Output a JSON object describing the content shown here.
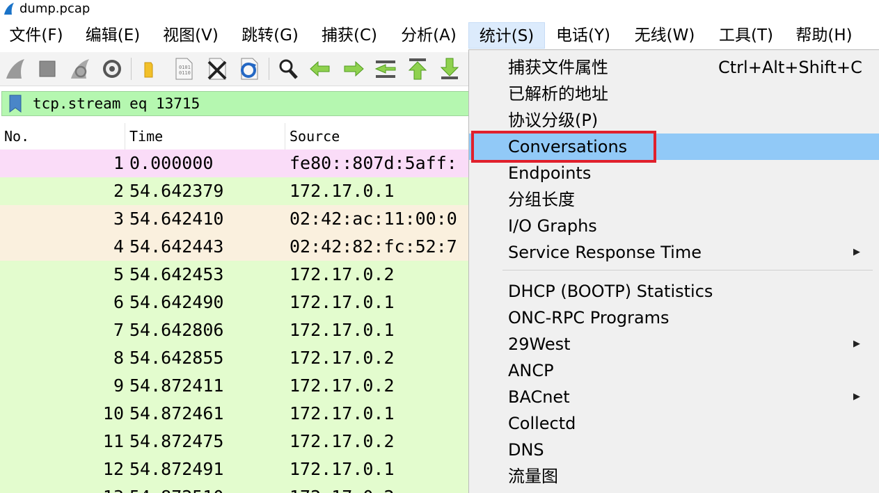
{
  "window": {
    "title": "dump.pcap"
  },
  "menubar": {
    "items": [
      {
        "label": "文件(F)"
      },
      {
        "label": "编辑(E)"
      },
      {
        "label": "视图(V)"
      },
      {
        "label": "跳转(G)"
      },
      {
        "label": "捕获(C)"
      },
      {
        "label": "分析(A)"
      },
      {
        "label": "统计(S)",
        "active": true
      },
      {
        "label": "电话(Y)"
      },
      {
        "label": "无线(W)"
      },
      {
        "label": "工具(T)"
      },
      {
        "label": "帮助(H)"
      }
    ]
  },
  "toolbar": {
    "icons": [
      "shark-fin-start-icon",
      "stop-capture-icon",
      "restart-capture-icon",
      "capture-options-icon",
      "open-file-icon",
      "save-file-icon",
      "close-file-icon",
      "reload-file-icon",
      "find-packet-icon",
      "go-back-icon",
      "go-forward-icon",
      "go-to-packet-icon",
      "go-first-icon",
      "go-last-icon"
    ]
  },
  "filter": {
    "value": "tcp.stream eq 13715",
    "color": "#b5f7b0"
  },
  "packet_list": {
    "columns": [
      "No.",
      "Time",
      "Source"
    ],
    "rows": [
      {
        "no": "1",
        "time": "0.000000",
        "source": "fe80::807d:5aff:",
        "bg": "#fadcf8"
      },
      {
        "no": "2",
        "time": "54.642379",
        "source": "172.17.0.1",
        "bg": "#e3fcce"
      },
      {
        "no": "3",
        "time": "54.642410",
        "source": "02:42:ac:11:00:0",
        "bg": "#faf0de"
      },
      {
        "no": "4",
        "time": "54.642443",
        "source": "02:42:82:fc:52:7",
        "bg": "#faf0de"
      },
      {
        "no": "5",
        "time": "54.642453",
        "source": "172.17.0.2",
        "bg": "#e3fcce"
      },
      {
        "no": "6",
        "time": "54.642490",
        "source": "172.17.0.1",
        "bg": "#e3fcce"
      },
      {
        "no": "7",
        "time": "54.642806",
        "source": "172.17.0.1",
        "bg": "#e3fcce"
      },
      {
        "no": "8",
        "time": "54.642855",
        "source": "172.17.0.2",
        "bg": "#e3fcce"
      },
      {
        "no": "9",
        "time": "54.872411",
        "source": "172.17.0.2",
        "bg": "#e3fcce"
      },
      {
        "no": "10",
        "time": "54.872461",
        "source": "172.17.0.1",
        "bg": "#e3fcce"
      },
      {
        "no": "11",
        "time": "54.872475",
        "source": "172.17.0.2",
        "bg": "#e3fcce"
      },
      {
        "no": "12",
        "time": "54.872491",
        "source": "172.17.0.1",
        "bg": "#e3fcce"
      },
      {
        "no": "13",
        "time": "54.872510",
        "source": "172.17.0.2",
        "bg": "#e3fcce"
      }
    ]
  },
  "statistics_menu": {
    "items": [
      {
        "label": "捕获文件属性",
        "shortcut": "Ctrl+Alt+Shift+C"
      },
      {
        "label": "已解析的地址"
      },
      {
        "label": "协议分级(P)"
      },
      {
        "label": "Conversations",
        "highlighted": true
      },
      {
        "label": "Endpoints"
      },
      {
        "label": "分组长度"
      },
      {
        "label": "I/O Graphs"
      },
      {
        "label": "Service Response Time",
        "submenu": true
      },
      {
        "label": "DHCP (BOOTP) Statistics"
      },
      {
        "label": "ONC-RPC Programs"
      },
      {
        "label": "29West",
        "submenu": true
      },
      {
        "label": "ANCP"
      },
      {
        "label": "BACnet",
        "submenu": true
      },
      {
        "label": "Collectd"
      },
      {
        "label": "DNS"
      },
      {
        "label": "流量图"
      }
    ],
    "highlight_color": "#91c9f7",
    "annotation_color": "#e0202c"
  }
}
